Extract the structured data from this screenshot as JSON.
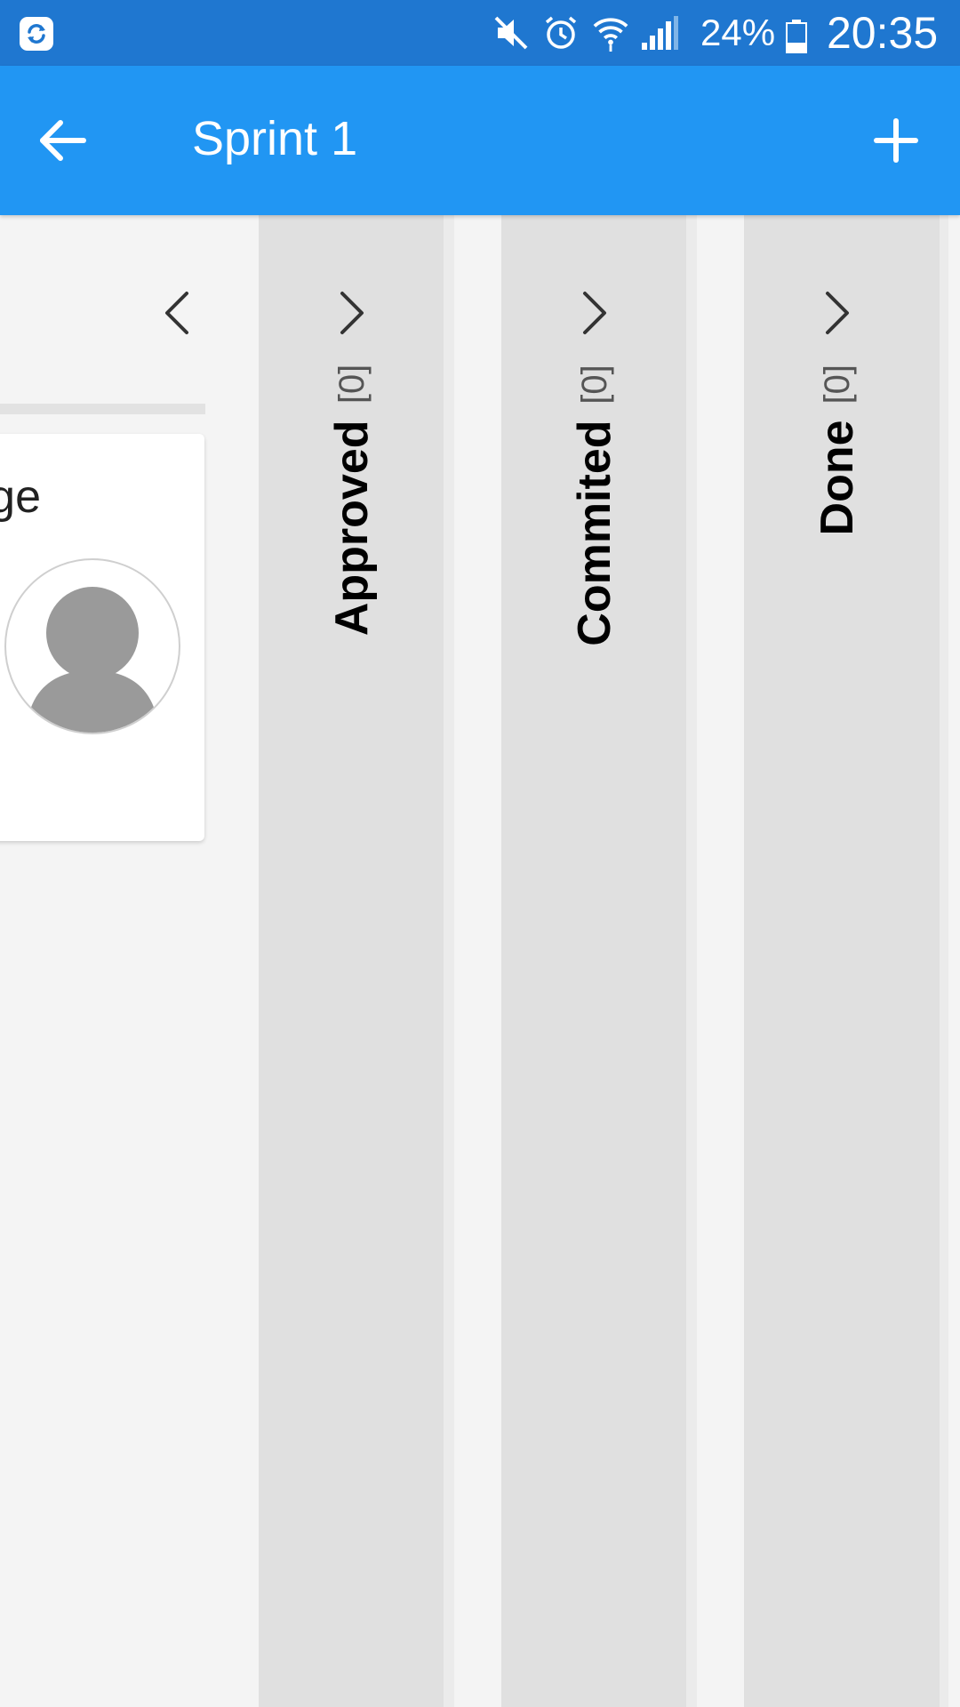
{
  "status_bar": {
    "battery_percent": "24%",
    "time": "20:35",
    "icons": [
      "sync-app-icon",
      "mute-icon",
      "alarm-icon",
      "wifi-icon",
      "signal-icon",
      "battery-icon"
    ]
  },
  "app_bar": {
    "title": "Sprint 1",
    "back_icon": "arrow-left-icon",
    "add_icon": "plus-icon"
  },
  "board": {
    "expanded_column": {
      "cards": [
        {
          "title_fragment": "age",
          "avatar_icon": "default-avatar-icon"
        }
      ]
    },
    "collapsed_columns": [
      {
        "name": "Approved",
        "count": "[0]"
      },
      {
        "name": "Commited",
        "count": "[0]"
      },
      {
        "name": "Done",
        "count": "[0]"
      }
    ]
  },
  "colors": {
    "status_bar": "#1f77d0",
    "app_bar": "#2196f3",
    "board_background": "#f4f4f4",
    "collapsed_column": "#e0e0e0",
    "card": "#ffffff"
  }
}
